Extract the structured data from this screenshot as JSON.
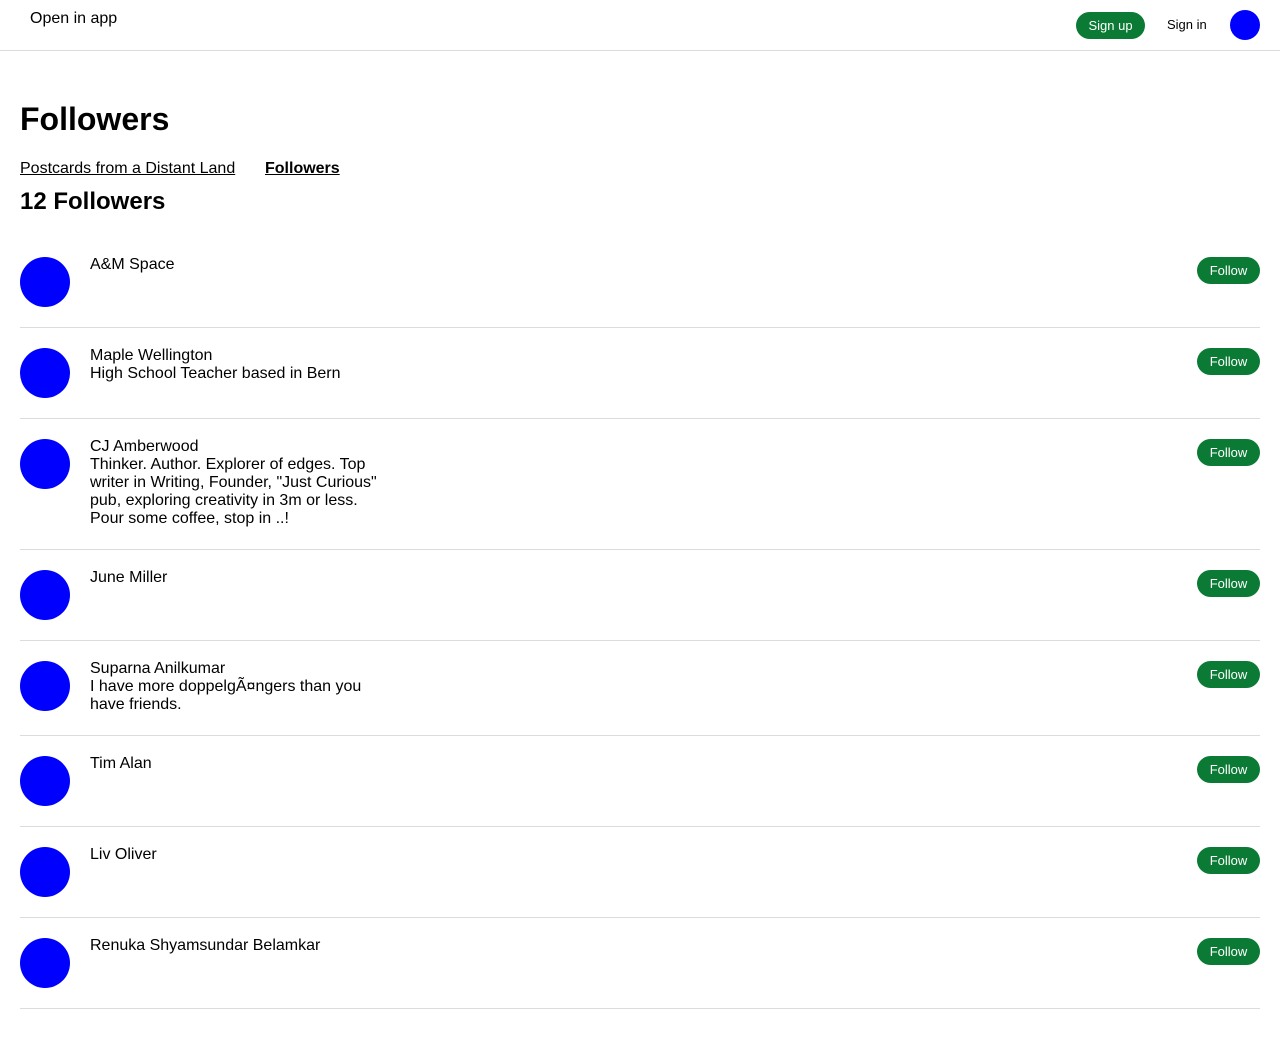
{
  "header": {
    "open_in_app": "Open in app",
    "sign_up": "Sign up",
    "sign_in": "Sign in"
  },
  "page": {
    "title": "Followers",
    "breadcrumb": [
      "Postcards from a Distant Land",
      "Followers"
    ],
    "count_label": "12 Followers"
  },
  "follow_label": "Follow",
  "followers": [
    {
      "name": "A&M Space",
      "bio": ""
    },
    {
      "name": "Maple Wellington",
      "bio": "High School Teacher based in Bern"
    },
    {
      "name": "CJ Amberwood",
      "bio": "Thinker. Author. Explorer of edges. Top writer in Writing, Founder, \"Just Curious\" pub, exploring creativity in 3m or less. Pour some coffee, stop in ..!"
    },
    {
      "name": "June Miller",
      "bio": ""
    },
    {
      "name": "Suparna Anilkumar",
      "bio": "I have more doppelgÃ¤ngers than you have friends."
    },
    {
      "name": "Tim Alan",
      "bio": ""
    },
    {
      "name": "Liv Oliver",
      "bio": ""
    },
    {
      "name": "Renuka Shyamsundar Belamkar",
      "bio": ""
    }
  ],
  "colors": {
    "accent": "#0a7a35",
    "avatar": "#0000ff",
    "divider": "#dcdcdc"
  }
}
